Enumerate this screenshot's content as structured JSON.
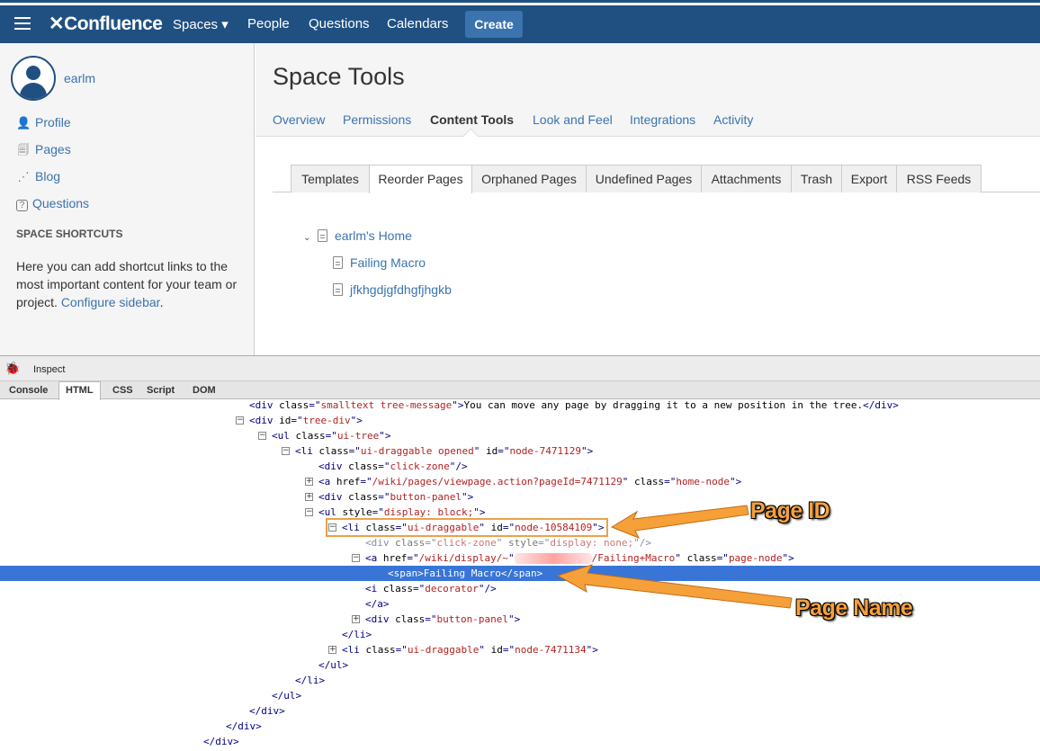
{
  "nav": {
    "logo": "Confluence",
    "items": [
      "Spaces ▾",
      "People",
      "Questions",
      "Calendars"
    ],
    "create": "Create"
  },
  "sidebar": {
    "username": "earlm",
    "links": [
      "Profile",
      "Pages",
      "Blog",
      "Questions"
    ],
    "shortcuts_title": "SPACE SHORTCUTS",
    "shortcuts_text": "Here you can add shortcut links to the most important content for your team or project. ",
    "configure_link": "Configure sidebar",
    "configure_tail": "."
  },
  "main": {
    "title": "Space Tools",
    "tabs": [
      "Overview",
      "Permissions",
      "Content Tools",
      "Look and Feel",
      "Integrations",
      "Activity"
    ],
    "subtabs": [
      "Templates",
      "Reorder Pages",
      "Orphaned Pages",
      "Undefined Pages",
      "Attachments",
      "Trash",
      "Export",
      "RSS Feeds"
    ],
    "tree": {
      "home": "earlm's Home",
      "children": [
        "Failing Macro",
        "jfkhgdjgfdhgfjhgkb"
      ]
    }
  },
  "devtools": {
    "inspect": "Inspect",
    "tabs": [
      "Console",
      "HTML",
      "CSS",
      "Script",
      "DOM"
    ],
    "code": [
      {
        "tag": "<div ",
        "attrs": [
          [
            "class",
            "smalltext tree-message"
          ]
        ],
        "close": ">",
        "text": "You can move any page by dragging it to a new position in the tree.",
        "end": "</div>"
      },
      {
        "tag": "<div ",
        "attrs": [
          [
            "id",
            "tree-div"
          ]
        ],
        "close": ">"
      },
      {
        "tag": "<ul ",
        "attrs": [
          [
            "class",
            "ui-tree"
          ]
        ],
        "close": ">"
      },
      {
        "tag": "<li ",
        "attrs": [
          [
            "class",
            "ui-draggable opened"
          ],
          [
            "id",
            "node-7471129"
          ]
        ],
        "close": ">"
      },
      {
        "tag": "<div ",
        "attrs": [
          [
            "class",
            "click-zone"
          ]
        ],
        "close": "/>"
      },
      {
        "tag": "<a ",
        "attrs": [
          [
            "href",
            "/wiki/pages/viewpage.action?pageId=7471129"
          ],
          [
            "class",
            "home-node"
          ]
        ],
        "close": ">"
      },
      {
        "tag": "<div ",
        "attrs": [
          [
            "class",
            "button-panel"
          ]
        ],
        "close": ">"
      },
      {
        "tag": "<ul ",
        "attrs": [
          [
            "style",
            "display: block;"
          ]
        ],
        "close": ">"
      },
      {
        "tag": "<li ",
        "attrs": [
          [
            "class",
            "ui-draggable"
          ],
          [
            "id",
            "node-10584109"
          ]
        ],
        "close": ">"
      },
      {
        "tag": "<div ",
        "attrs": [
          [
            "class",
            "click-zone"
          ],
          [
            "style",
            "display: none;"
          ]
        ],
        "close": "/>"
      },
      {
        "tag": "<a ",
        "attrs": [
          [
            "href",
            "/wiki/display/~"
          ]
        ],
        "mid": "/Failing+Macro\"",
        "attrs2": [
          [
            "class",
            "page-node"
          ]
        ],
        "close": ">"
      },
      {
        "tag": "<span>",
        "attrs": [],
        "close": "",
        "text": "Failing Macro",
        "end": "</span>"
      },
      {
        "tag": "<i ",
        "attrs": [
          [
            "class",
            "decorator"
          ]
        ],
        "close": "/>"
      },
      {
        "tag": "</a>",
        "attrs": [],
        "close": ""
      },
      {
        "tag": "<div ",
        "attrs": [
          [
            "class",
            "button-panel"
          ]
        ],
        "close": ">"
      },
      {
        "tag": "</li>",
        "attrs": [],
        "close": ""
      },
      {
        "tag": "<li ",
        "attrs": [
          [
            "class",
            "ui-draggable"
          ],
          [
            "id",
            "node-7471134"
          ]
        ],
        "close": ">"
      },
      {
        "tag": "</ul>",
        "attrs": [],
        "close": ""
      },
      {
        "tag": "</li>",
        "attrs": [],
        "close": ""
      },
      {
        "tag": "</ul>",
        "attrs": [],
        "close": ""
      },
      {
        "tag": "</div>",
        "attrs": [],
        "close": ""
      },
      {
        "tag": "</div>",
        "attrs": [],
        "close": ""
      },
      {
        "tag": "</div>",
        "attrs": [],
        "close": ""
      }
    ]
  },
  "annotations": {
    "page_id": "Page ID",
    "page_name": "Page Name",
    "color": "#f6a03a"
  },
  "colors": {
    "nav_bg": "#205081",
    "link": "#3b73af",
    "selected": "#3875d7"
  }
}
